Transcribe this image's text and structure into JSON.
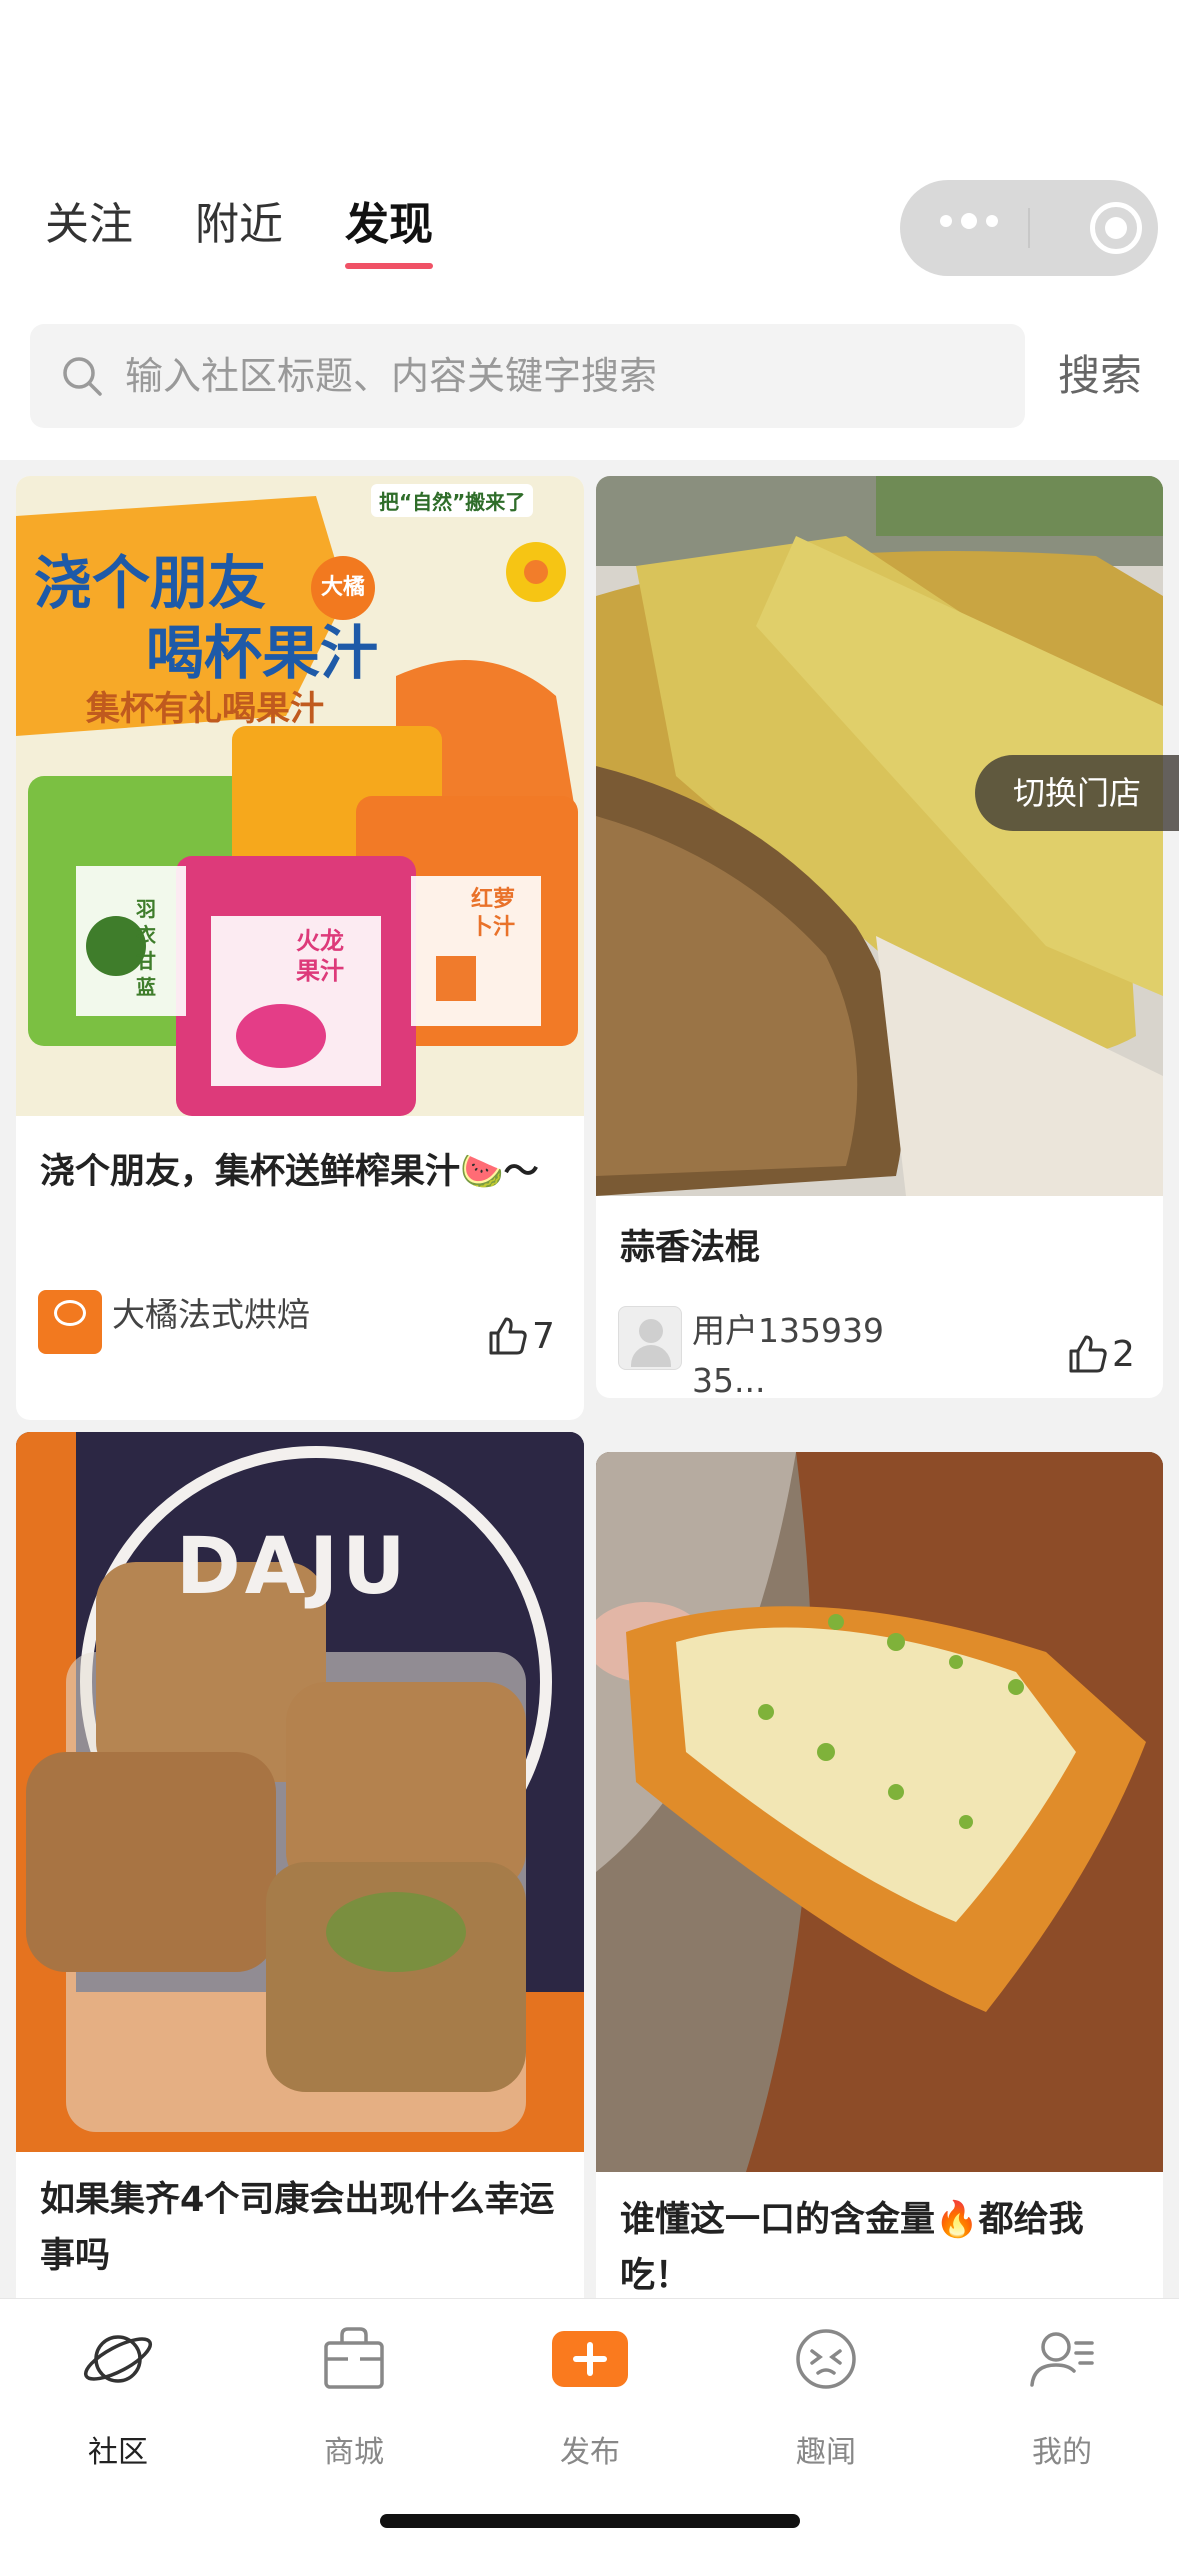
{
  "tabs": [
    {
      "label": "关注",
      "active": false
    },
    {
      "label": "附近",
      "active": false
    },
    {
      "label": "发现",
      "active": true
    }
  ],
  "capsule": {
    "menu_icon": "more-dots-icon",
    "close_icon": "target-circle-icon"
  },
  "search": {
    "placeholder": "输入社区标题、内容关键字搜索",
    "button_label": "搜索",
    "icon": "search-icon"
  },
  "switch_store_label": "切换门店",
  "feed": [
    {
      "title": "浇个朋友，集杯送鲜榨果汁🍉～",
      "author": "大橘法式烘焙",
      "likes": "7",
      "poster": {
        "headline1": "浇个朋友",
        "headline2": "喝杯果汁",
        "subline": "集杯有礼喝果汁",
        "badge": "把“自然”搬来了",
        "brand": "大橘",
        "cup_labels": [
          "羽衣甘蓝",
          "火龙果汁",
          "红萝卜汁"
        ]
      }
    },
    {
      "title": "蒜香法棍",
      "author": "用户13593935...",
      "likes": "2"
    },
    {
      "title": "如果集齐4个司康会出现什么幸运事吗",
      "sign": "DAJU"
    },
    {
      "title": "谁懂这一口的含金量🔥都给我吃！"
    }
  ],
  "tabbar": [
    {
      "label": "社区",
      "icon": "planet-icon",
      "active": true
    },
    {
      "label": "商城",
      "icon": "shopping-bag-icon",
      "active": false
    },
    {
      "label": "发布",
      "icon": "plus-icon",
      "active": false
    },
    {
      "label": "趣闻",
      "icon": "face-icon",
      "active": false
    },
    {
      "label": "我的",
      "icon": "user-list-icon",
      "active": false
    }
  ],
  "colors": {
    "accent": "#f05266",
    "publish": "#fa7a1e",
    "brand_orange": "#f2791f"
  }
}
